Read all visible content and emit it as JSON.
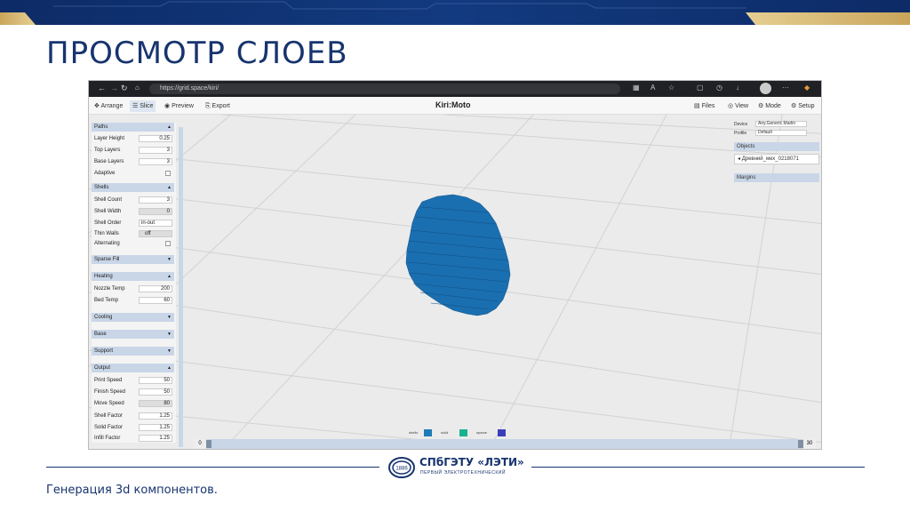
{
  "slide": {
    "title": "ПРОСМОТР СЛОЕВ",
    "footer_text": "Генерация 3d компонентов.",
    "logo_name": "СПбГЭТУ «ЛЭТИ»",
    "logo_sub": "ПЕРВЫЙ ЭЛЕКТРОТЕХНИЧЕСКИЙ",
    "logo_badge": "1886"
  },
  "browser": {
    "url": "https://grid.space/kiri/",
    "back_icon": "arrow-left-icon",
    "refresh_icon": "reload-icon"
  },
  "app": {
    "title": "Kiri:Moto",
    "tabs_left": [
      "Arrange",
      "Slice",
      "Preview",
      "Export"
    ],
    "active_tab": "Slice",
    "tabs_right": [
      "Files",
      "View",
      "Mode",
      "Setup"
    ]
  },
  "left_panel": {
    "paths": {
      "header": "Paths",
      "rows": [
        {
          "label": "Layer Height",
          "value": "0.25"
        },
        {
          "label": "Top Layers",
          "value": "3"
        },
        {
          "label": "Base Layers",
          "value": "3"
        },
        {
          "label": "Adaptive",
          "value": ""
        }
      ]
    },
    "shells": {
      "header": "Shells",
      "rows": [
        {
          "label": "Shell Count",
          "value": "3"
        },
        {
          "label": "Shell Width",
          "value": "0"
        },
        {
          "label": "Shell Order",
          "value": "in-out"
        },
        {
          "label": "Thin Walls",
          "value": "off"
        },
        {
          "label": "Alternating",
          "value": ""
        }
      ]
    },
    "sparse_fill": {
      "header": "Sparse Fill"
    },
    "heating": {
      "header": "Heating",
      "rows": [
        {
          "label": "Nozzle Temp",
          "value": "200"
        },
        {
          "label": "Bed Temp",
          "value": "60"
        }
      ]
    },
    "cooling": {
      "header": "Cooling"
    },
    "base": {
      "header": "Base"
    },
    "support": {
      "header": "Support"
    },
    "output": {
      "header": "Output",
      "rows": [
        {
          "label": "Print Speed",
          "value": "50"
        },
        {
          "label": "Finish Speed",
          "value": "50"
        },
        {
          "label": "Move Speed",
          "value": "80"
        },
        {
          "label": "Shell Factor",
          "value": "1.25"
        },
        {
          "label": "Solid Factor",
          "value": "1.25"
        },
        {
          "label": "Infill Factor",
          "value": "1.25"
        }
      ]
    }
  },
  "right_panel": {
    "device_label": "Device",
    "device_value": "Any.Generic.Marlin",
    "profile_label": "Profile",
    "profile_value": "Default",
    "objects_header": "Objects",
    "object_name": "Древний_мех_0218071",
    "margins_header": "Margins"
  },
  "legend": [
    {
      "label": "shells",
      "color": "#1f7ab8"
    },
    {
      "label": "solid fill",
      "color": "#17b38f"
    },
    {
      "label": "sparse fill",
      "color": "#3a3fb8"
    }
  ],
  "timeline": {
    "start": "0",
    "end": "30"
  },
  "colors": {
    "model": "#1a6fb0",
    "brand_blue": "#17346f",
    "panel_header": "#c9d6e8"
  }
}
